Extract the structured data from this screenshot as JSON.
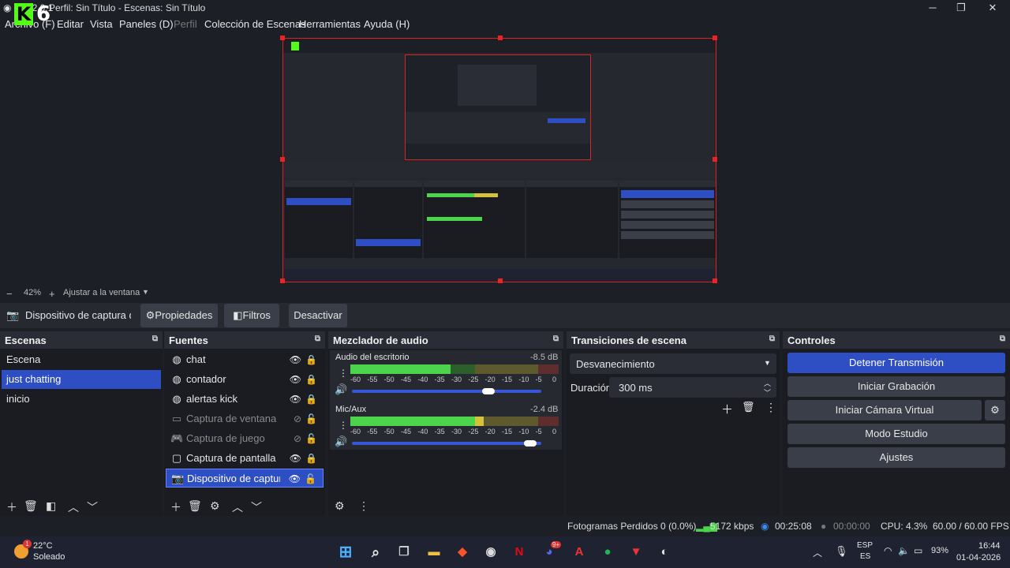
{
  "window": {
    "title": "Perfil: Sin Título - Escenas: Sin Título",
    "version_fragment": "32.0.1",
    "minimize": "─",
    "maximize": "❐",
    "close": "✕",
    "logo_text": "6"
  },
  "menu": [
    "Archivo (F)",
    "Editar",
    "Vista",
    "Paneles (D)",
    "Perfil",
    "Colección de Escenas",
    "Herramientas",
    "Ayuda (H)"
  ],
  "zoom": {
    "minus": "−",
    "level": "42%",
    "plus": "+",
    "fit_label": "Ajustar a la ventana"
  },
  "source_toolbar": {
    "source_name": "Dispositivo de captura de v",
    "properties_label": "Propiedades",
    "filters_label": "Filtros",
    "deactivate_label": "Desactivar"
  },
  "scenes": {
    "title": "Escenas",
    "items": [
      "Escena",
      "just chatting",
      "inicio"
    ],
    "selected_index": 1
  },
  "sources": {
    "title": "Fuentes",
    "items": [
      {
        "label": "chat",
        "icon": "browser-icon",
        "visible": true,
        "locked": true
      },
      {
        "label": "contador",
        "icon": "browser-icon",
        "visible": true,
        "locked": true
      },
      {
        "label": "alertas kick",
        "icon": "browser-icon",
        "visible": true,
        "locked": true
      },
      {
        "label": "Captura de ventana",
        "icon": "window-icon",
        "visible": false,
        "locked": false
      },
      {
        "label": "Captura de juego",
        "icon": "gamepad-icon",
        "visible": false,
        "locked": false
      },
      {
        "label": "Captura de pantalla",
        "icon": "monitor-icon",
        "visible": true,
        "locked": true
      },
      {
        "label": "Dispositivo de captura de video",
        "icon": "camera-icon",
        "visible": true,
        "locked": false
      }
    ],
    "selected_index": 6
  },
  "mixer": {
    "title": "Mezclador de audio",
    "ticks": [
      "-60",
      "-55",
      "-50",
      "-45",
      "-40",
      "-35",
      "-30",
      "-25",
      "-20",
      "-15",
      "-10",
      "-5",
      "0"
    ],
    "channels": [
      {
        "name": "Audio del escritorio",
        "db": "-8.5 dB",
        "level": 0.48,
        "volume": 0.72
      },
      {
        "name": "Mic/Aux",
        "db": "-2.4 dB",
        "level": 0.64,
        "volume": 0.94
      }
    ]
  },
  "transitions": {
    "title": "Transiciones de escena",
    "selected": "Desvanecimiento",
    "duration_label": "Duración",
    "duration_value": "300 ms"
  },
  "controls": {
    "title": "Controles",
    "stop_stream": "Detener Transmisión",
    "start_recording": "Iniciar Grabación",
    "start_virtual_cam": "Iniciar Cámara Virtual",
    "studio_mode": "Modo Estudio",
    "settings": "Ajustes"
  },
  "status": {
    "dropped_frames": "Fotogramas Perdidos 0 (0.0%)",
    "bitrate": "5172 kbps",
    "stream_time": "00:25:08",
    "record_time": "00:00:00",
    "cpu": "CPU: 4.3%",
    "fps": "60.00 / 60.00 FPS"
  },
  "taskbar": {
    "weather_temp": "22°C",
    "weather_desc": "Soleado",
    "weather_badge": "1",
    "language": "ESP",
    "region": "ES",
    "battery": "93%",
    "time": "16:44",
    "date": "01-04-2026",
    "discord_badge": "9+"
  },
  "colors": {
    "accent": "#2e4ec4",
    "kick_green": "#53fc18",
    "meter_green": "#4cd44c",
    "meter_yellow": "#d4c23c",
    "meter_red": "#c23c3c"
  }
}
